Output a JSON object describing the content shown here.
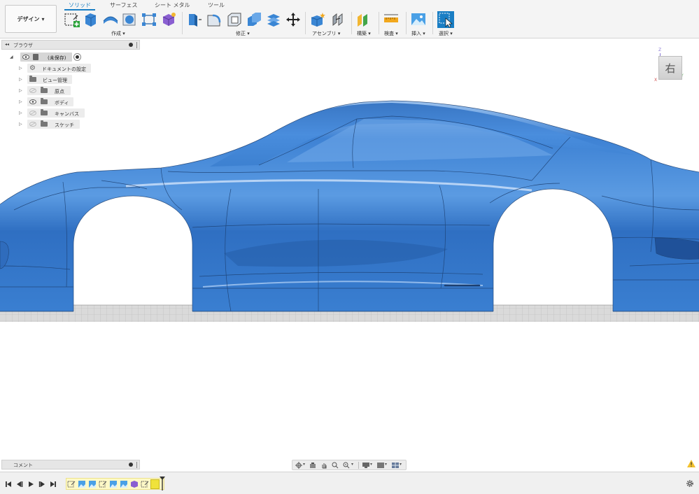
{
  "workspace": {
    "label": "デザイン",
    "caret": "▾"
  },
  "tabs": [
    {
      "label": "ソリッド",
      "active": true
    },
    {
      "label": "サーフェス",
      "active": false
    },
    {
      "label": "シート メタル",
      "active": false
    },
    {
      "label": "ツール",
      "active": false
    }
  ],
  "groups": {
    "create": "作成 ▾",
    "modify": "修正 ▾",
    "assemble": "アセンブリ ▾",
    "construct": "構築 ▾",
    "inspect": "検査 ▾",
    "insert": "挿入 ▾",
    "select": "選択 ▾"
  },
  "browser": {
    "title": "ブラウザ",
    "collapse_icon": "◂◂",
    "root": "(未保存)",
    "items": [
      {
        "label": "ドキュメントの設定"
      },
      {
        "label": "ビュー管理"
      },
      {
        "label": "原点"
      },
      {
        "label": "ボディ"
      },
      {
        "label": "キャンバス"
      },
      {
        "label": "スケッチ"
      }
    ]
  },
  "viewcube": {
    "face": "右",
    "axis_z": "Z",
    "axis_y": "Y",
    "axis_x": "X"
  },
  "comments": {
    "title": "コメント"
  },
  "colors": {
    "accent": "#1a7ec4",
    "body_blue": "#3f86d8",
    "toolbar_bg": "#f4f4f4",
    "timeline_marker": "#f0e23a"
  },
  "icons": [
    "workspace-menu",
    "sketch-icon",
    "box-icon",
    "extrude-icon",
    "revolve-icon",
    "form-icon",
    "press-pull-icon",
    "fillet-icon",
    "shell-icon",
    "combine-icon",
    "replace-face-icon",
    "move-icon",
    "new-component-icon",
    "joint-icon",
    "offset-plane-icon",
    "measure-icon",
    "insert-image-icon",
    "select-icon",
    "gear-icon",
    "eye-icon",
    "folder-icon",
    "warning-icon"
  ]
}
